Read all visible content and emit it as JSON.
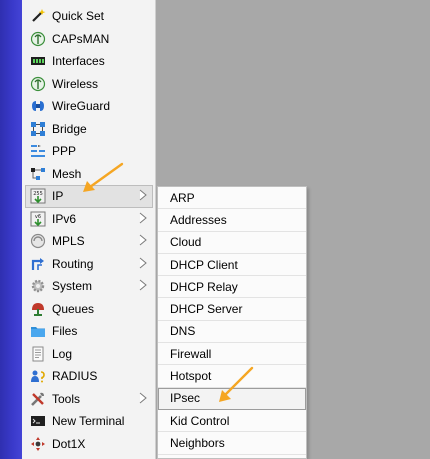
{
  "menu": {
    "items": [
      {
        "label": "Quick Set",
        "icon": "wand-icon"
      },
      {
        "label": "CAPsMAN",
        "icon": "antenna-icon"
      },
      {
        "label": "Interfaces",
        "icon": "interface-icon"
      },
      {
        "label": "Wireless",
        "icon": "antenna-icon"
      },
      {
        "label": "WireGuard",
        "icon": "wireguard-icon"
      },
      {
        "label": "Bridge",
        "icon": "bridge-icon"
      },
      {
        "label": "PPP",
        "icon": "ppp-icon"
      },
      {
        "label": "Mesh",
        "icon": "mesh-icon"
      },
      {
        "label": "IP",
        "icon": "ip-icon"
      },
      {
        "label": "IPv6",
        "icon": "ipv6-icon"
      },
      {
        "label": "MPLS",
        "icon": "mpls-icon"
      },
      {
        "label": "Routing",
        "icon": "routing-icon"
      },
      {
        "label": "System",
        "icon": "system-icon"
      },
      {
        "label": "Queues",
        "icon": "queues-icon"
      },
      {
        "label": "Files",
        "icon": "folder-icon"
      },
      {
        "label": "Log",
        "icon": "log-icon"
      },
      {
        "label": "RADIUS",
        "icon": "radius-icon"
      },
      {
        "label": "Tools",
        "icon": "tools-icon"
      },
      {
        "label": "New Terminal",
        "icon": "terminal-icon"
      },
      {
        "label": "Dot1X",
        "icon": "dot1x-icon"
      }
    ],
    "selected": "IP"
  },
  "submenu": {
    "items": [
      "ARP",
      "Addresses",
      "Cloud",
      "DHCP Client",
      "DHCP Relay",
      "DHCP Server",
      "DNS",
      "Firewall",
      "Hotspot",
      "IPsec",
      "Kid Control",
      "Neighbors"
    ],
    "selected": "IPsec"
  },
  "colors": {
    "sidebar_strip": "#3a3acb",
    "menu_background": "#f3f3f3",
    "workspace_background": "#a8a8a8",
    "annotation_arrow": "#f5a623"
  }
}
